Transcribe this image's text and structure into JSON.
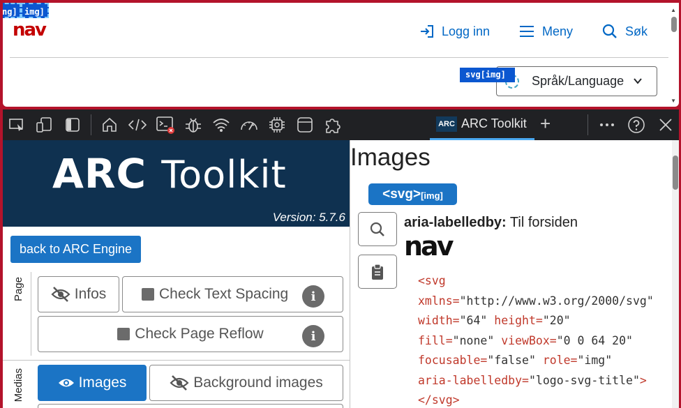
{
  "webpage": {
    "tag1_label": "ng]",
    "tag2_label": "img]",
    "logo_text": "nav",
    "nav": {
      "login_label": "Logg inn",
      "menu_label": "Meny",
      "search_label": "Søk"
    },
    "svg_img_tag": "svg[img]",
    "language_select": {
      "value": "Språk/Language"
    }
  },
  "devtools": {
    "active_tab_label": "ARC Toolkit",
    "arc_mini_label": "ARC",
    "toolbar_icons": [
      "inspect-icon",
      "device-emulation-icon",
      "sidebar-icon",
      "home-icon",
      "elements-icon",
      "console-icon",
      "sources-icon",
      "network-icon",
      "performance-icon",
      "memory-icon",
      "application-icon",
      "extensions-icon"
    ],
    "right_icons": [
      "more-icon",
      "help-icon",
      "close-icon"
    ],
    "colors": {
      "accent": "#1b74c5",
      "banner": "#0f3150",
      "frame": "#b3132b",
      "nav_red": "#c30000",
      "link_blue": "#0067c5"
    }
  },
  "arc": {
    "banner_title_a": "ARC",
    "banner_title_b": "Toolkit",
    "version": "Version: 5.7.6",
    "back_button": "back to ARC Engine",
    "section_page": "Page",
    "section_medias": "Medias",
    "buttons": {
      "infos": "Infos",
      "text_spacing": "Check Text Spacing",
      "page_reflow": "Check Page Reflow",
      "images": "Images",
      "background_images": "Background images"
    }
  },
  "results": {
    "heading": "Images",
    "chip_main": "<svg>",
    "chip_sub": "[img]",
    "aria_key": "aria-labelledby:",
    "aria_value": "Til forsiden",
    "logo_text": "nav",
    "code": {
      "l1": "<svg",
      "l2a": "xmlns=",
      "l2b": "\"http://www.w3.org/2000/svg\"",
      "l3a": "width=",
      "l3b": "\"64\"",
      "l3c": " height=",
      "l3d": "\"20\"",
      "l4a": "fill=",
      "l4b": "\"none\"",
      "l4c": " viewBox=",
      "l4d": "\"0 0 64 20\"",
      "l5a": "focusable=",
      "l5b": "\"false\"",
      "l5c": " role=",
      "l5d": "\"img\"",
      "l6a": "aria-labelledby=",
      "l6b": "\"logo-svg-title\"",
      "l6c": ">",
      "l7": "</svg>"
    }
  }
}
